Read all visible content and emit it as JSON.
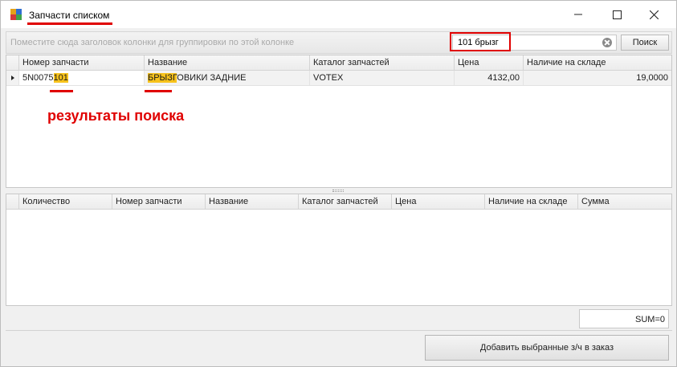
{
  "window": {
    "title": "Запчасти списком",
    "minimize_icon": "minimize-icon",
    "maximize_icon": "maximize-icon",
    "close_icon": "close-icon"
  },
  "group_panel": {
    "hint": "Поместите сюда заголовок колонки для группировки по этой колонке"
  },
  "search": {
    "value": "101 брызг",
    "button_label": "Поиск",
    "clear_icon": "clear-icon"
  },
  "results_grid": {
    "columns": [
      "Номер запчасти",
      "Название",
      "Каталог запчастей",
      "Цена",
      "Наличие на складе"
    ],
    "rows": [
      {
        "part_number_prefix": "5N0075",
        "part_number_match": "101",
        "name_match": "БРЫЗГ",
        "name_suffix": "ОВИКИ ЗАДНИЕ",
        "catalog": "VOTEX",
        "price": "4132,00",
        "stock": "19,0000"
      }
    ]
  },
  "annotation": {
    "text": "результаты поиска",
    "color": "#e00000"
  },
  "selected_grid": {
    "columns": [
      "Количество",
      "Номер запчасти",
      "Название",
      "Каталог запчастей",
      "Цена",
      "Наличие на складе",
      "Сумма"
    ]
  },
  "summary": {
    "sum_text": "SUM=0"
  },
  "footer": {
    "add_button_label": "Добавить выбранные з/ч в заказ"
  },
  "colors": {
    "highlight": "#f7c21b",
    "annotation_red": "#e00000"
  }
}
